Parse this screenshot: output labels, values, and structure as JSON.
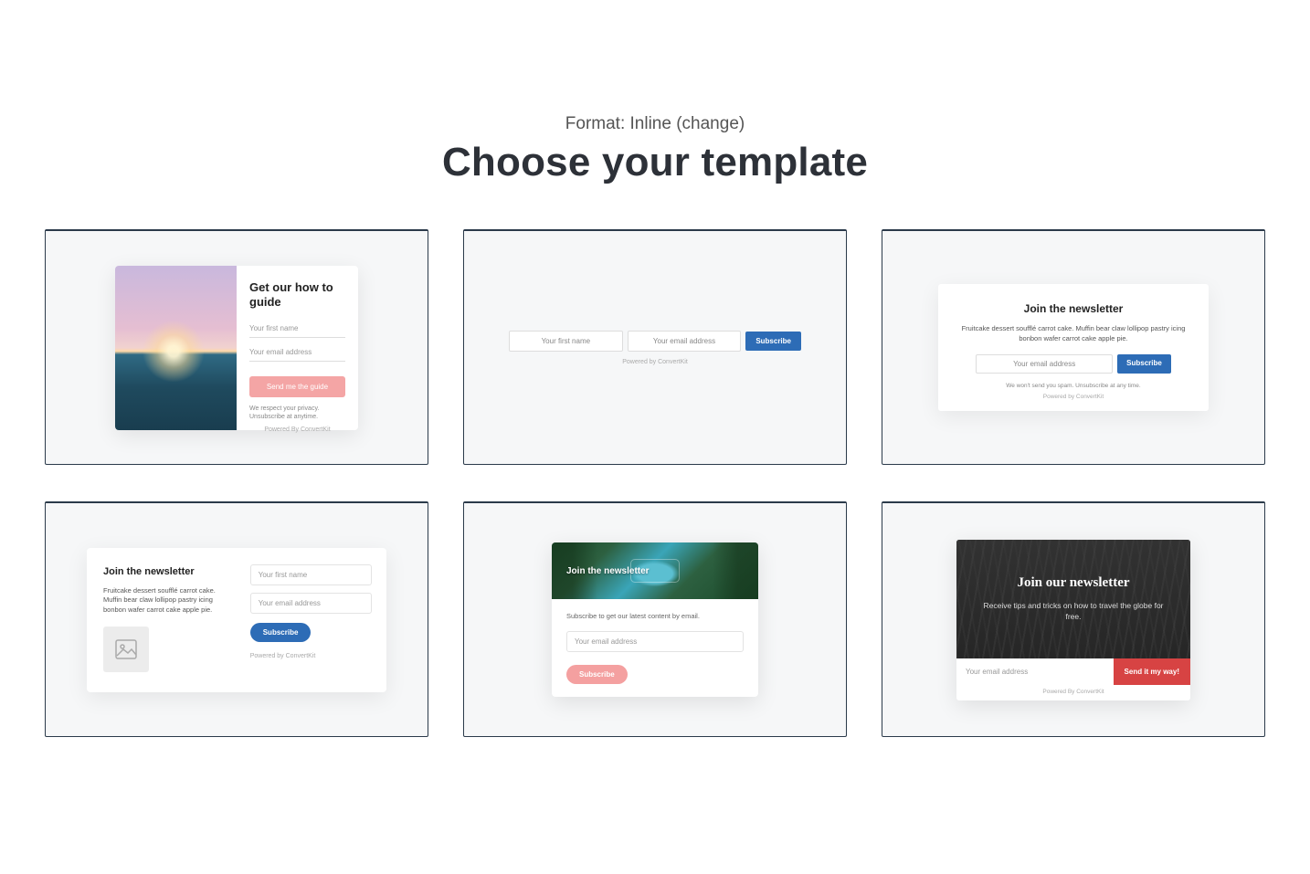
{
  "header": {
    "format_prefix": "Format: ",
    "format_value": "Inline",
    "change_label": "(change)",
    "title": "Choose your template"
  },
  "templates": {
    "t1": {
      "heading": "Get our how to guide",
      "firstname_ph": "Your first name",
      "email_ph": "Your email address",
      "button": "Send me the guide",
      "legal": "We respect your privacy. Unsubscribe at anytime.",
      "powered": "Powered By ConvertKit"
    },
    "t2": {
      "firstname_ph": "Your first name",
      "email_ph": "Your email address",
      "button": "Subscribe",
      "powered": "Powered by ConvertKit"
    },
    "t3": {
      "heading": "Join the newsletter",
      "desc": "Fruitcake dessert soufflé carrot cake. Muffin bear claw lollipop pastry icing bonbon wafer carrot cake apple pie.",
      "email_ph": "Your email address",
      "button": "Subscribe",
      "legal": "We won't send you spam. Unsubscribe at any time.",
      "powered": "Powered by ConvertKit"
    },
    "t4": {
      "heading": "Join the newsletter",
      "desc": "Fruitcake dessert soufflé carrot cake. Muffin bear claw lollipop pastry icing bonbon wafer carrot cake apple pie.",
      "firstname_ph": "Your first name",
      "email_ph": "Your email address",
      "button": "Subscribe",
      "powered": "Powered by ConvertKit"
    },
    "t5": {
      "heading": "Join the newsletter",
      "desc": "Subscribe to get our latest content by email.",
      "email_ph": "Your email address",
      "button": "Subscribe"
    },
    "t6": {
      "heading": "Join our newsletter",
      "desc": "Receive tips and tricks on how to travel the globe for free.",
      "email_ph": "Your email address",
      "button": "Send it my way!",
      "powered": "Powered By ConvertKit"
    }
  }
}
